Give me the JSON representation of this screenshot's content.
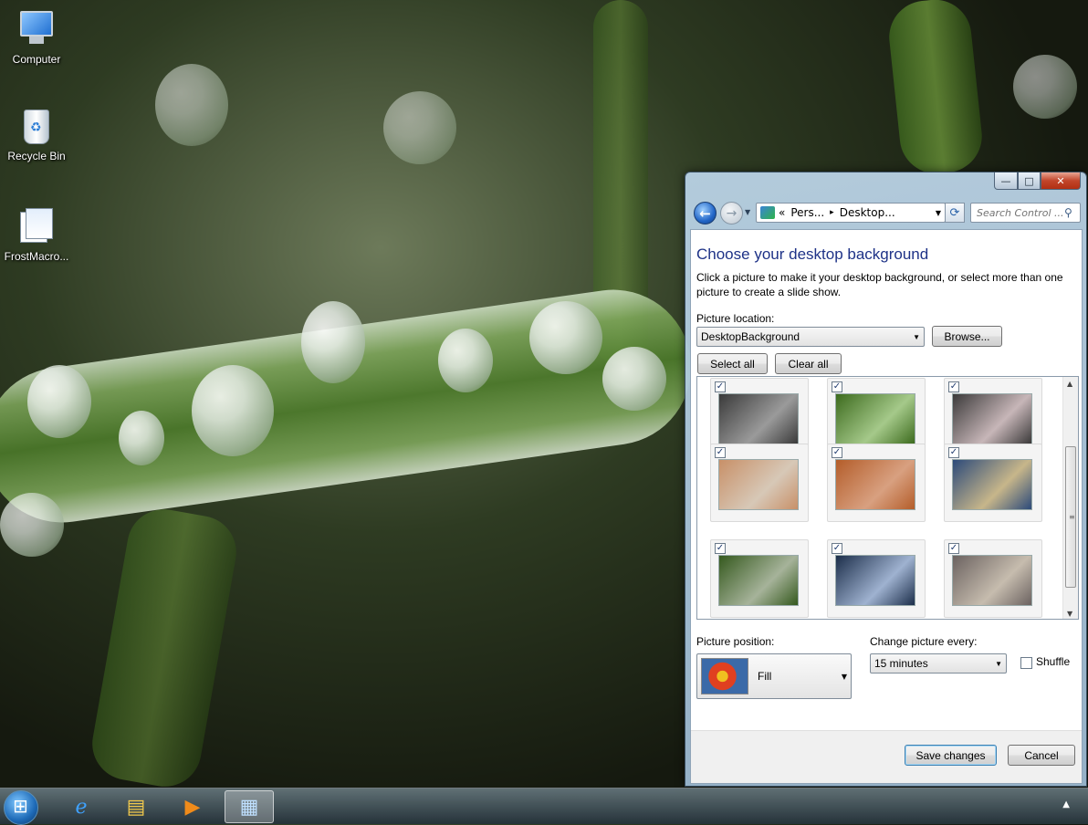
{
  "desktop": {
    "icons": [
      {
        "label": "Computer",
        "icon": "computer-icon"
      },
      {
        "label": "Recycle Bin",
        "icon": "recycle-bin-icon"
      },
      {
        "label": "FrostMacro...",
        "icon": "document-icon"
      }
    ]
  },
  "window": {
    "controls": {
      "minimize": "—",
      "maximize": "□",
      "close": "✕"
    },
    "nav": {
      "back_icon": "back-arrow-icon",
      "forward_icon": "forward-arrow-icon",
      "breadcrumb": [
        "«",
        "Pers...",
        "▸",
        "Desktop..."
      ],
      "search_placeholder": "Search Control ..."
    },
    "heading": "Choose your desktop background",
    "description": "Click a picture to make it your desktop background, or select more than one picture to create a slide show.",
    "location_label": "Picture location:",
    "location_value": "DesktopBackground",
    "browse_label": "Browse...",
    "select_all_label": "Select all",
    "clear_all_label": "Clear all",
    "thumbnails": [
      {
        "checked": true,
        "colors": [
          "#3a3a3a",
          "#9a9a9a"
        ]
      },
      {
        "checked": true,
        "colors": [
          "#3d6b1e",
          "#a5c98a"
        ]
      },
      {
        "checked": true,
        "colors": [
          "#3b3a3a",
          "#c7b6b8"
        ]
      },
      {
        "checked": true,
        "colors": [
          "#c89068",
          "#d7c8b7"
        ]
      },
      {
        "checked": true,
        "colors": [
          "#b45d2a",
          "#d8a080"
        ]
      },
      {
        "checked": true,
        "colors": [
          "#2c4a7a",
          "#c7b68a"
        ]
      },
      {
        "checked": true,
        "colors": [
          "#35591e",
          "#a6b39a"
        ]
      },
      {
        "checked": true,
        "colors": [
          "#1c2e4a",
          "#9fb2d0"
        ]
      },
      {
        "checked": true,
        "colors": [
          "#6b6260",
          "#c6bcae"
        ]
      }
    ],
    "position_label": "Picture position:",
    "position_value": "Fill",
    "interval_label": "Change picture every:",
    "interval_value": "15 minutes",
    "shuffle_label": "Shuffle",
    "shuffle_checked": false,
    "save_label": "Save changes",
    "cancel_label": "Cancel"
  },
  "taskbar": {
    "start_icon": "windows-start-orb-icon",
    "pinned": [
      "internet-explorer-icon",
      "windows-explorer-icon",
      "media-player-icon",
      "control-panel-icon"
    ],
    "active_index": 3,
    "tray_arrow": "▲"
  }
}
